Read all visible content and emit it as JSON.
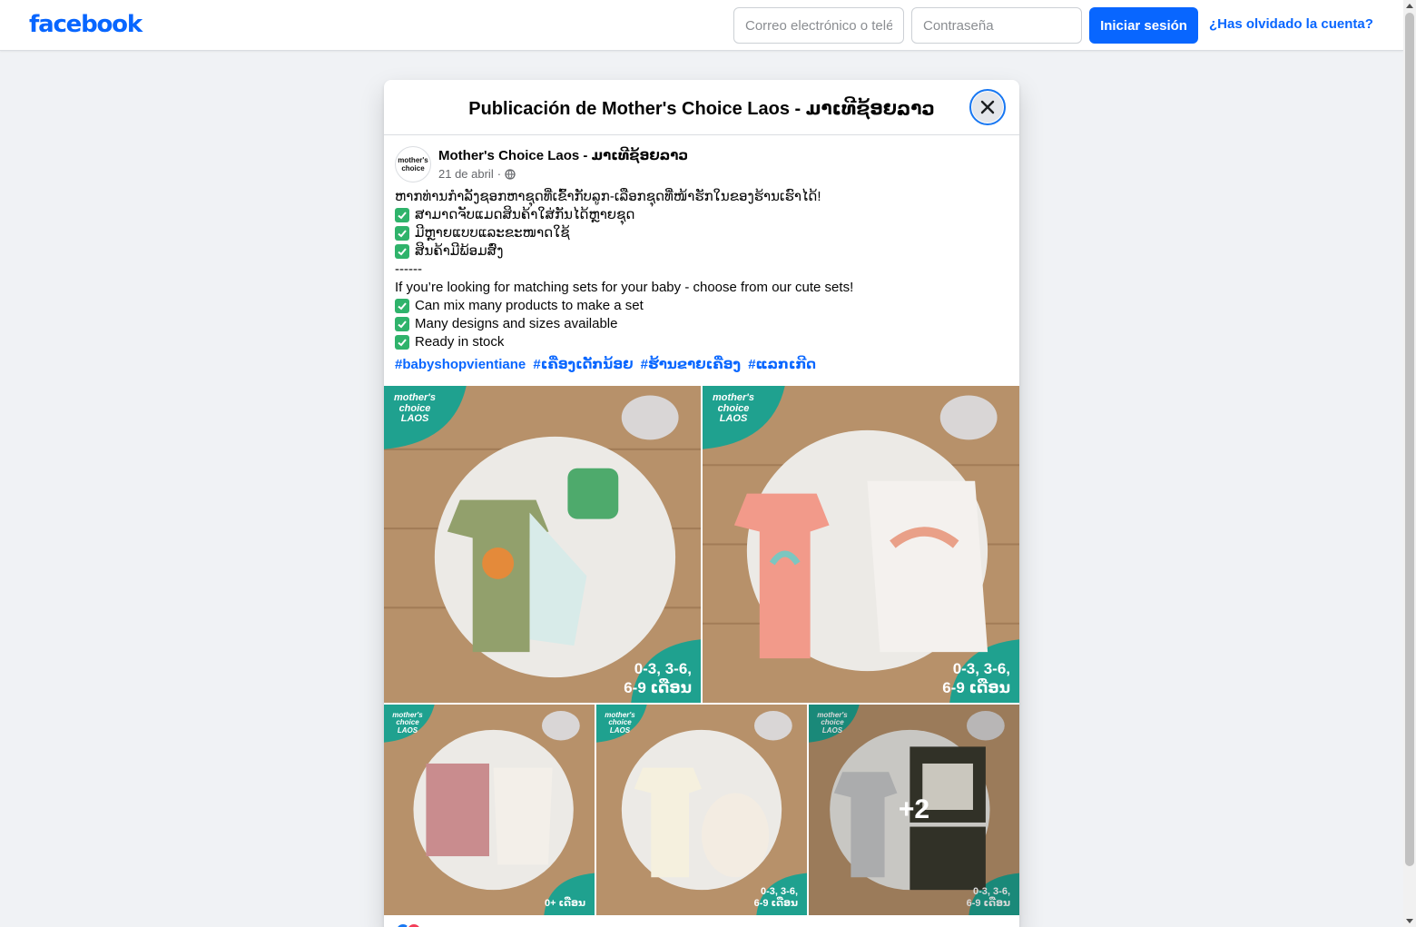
{
  "header": {
    "logo_text": "facebook",
    "email_placeholder": "Correo electrónico o teléfono",
    "password_placeholder": "Contraseña",
    "login_label": "Iniciar sesión",
    "forgot_label": "¿Has olvidado la cuenta?"
  },
  "dialog": {
    "title": "Publicación de Mother's Choice Laos - ມາເທີຊ້ອຍລາວ",
    "author": "Mother's Choice Laos - ມາເທີຊ້ອຍລາວ",
    "avatar_line1": "mother's",
    "avatar_line2": "choice",
    "date": "21 de abril",
    "separator": "·",
    "lines": [
      "ຫາກທ່ານກຳລັງຊອກຫາຊຸດທີ່ເຂົ້າກັບລູກ-ເລືອກຊຸດທີ່ໜ້າຮັກໃນຂອງຮ້ານເຮົາໄດ້!",
      "ສາມາດຈັບແມດສິນຄ້າໃສ່ກັນໄດ້ຫຼາຍຊຸດ",
      "ມີຫຼາຍແບບແລະຂະໜາດໃຊ້",
      "ສິນຄ້າມີພ້ອມສົ່ງ",
      "------",
      "If you’re looking for matching sets for your baby - choose from our cute sets!",
      "Can mix many products to make a set",
      "Many designs and sizes available",
      "Ready in stock"
    ],
    "hashtags": [
      "#babyshopvientiane",
      "#ເຄື່ອງເດັກນ້ອຍ",
      "#ຮ້ານຂາຍເຄື່ອງ",
      "#ແລກເກີດ"
    ],
    "photos": [
      {
        "brand": "mother's choice LAOS",
        "badge_line1": "0-3, 3-6,",
        "badge_line2": "6-9 ເດືອນ"
      },
      {
        "brand": "mother's choice LAOS",
        "badge_line1": "0-3, 3-6,",
        "badge_line2": "6-9 ເດືອນ"
      },
      {
        "brand": "mother's choice LAOS",
        "badge_line1": "",
        "badge_line2": "0+ ເດືອນ"
      },
      {
        "brand": "mother's choice LAOS",
        "badge_line1": "0-3, 3-6,",
        "badge_line2": "6-9 ເດືອນ"
      },
      {
        "brand": "mother's choice LAOS",
        "badge_line1": "0-3, 3-6,",
        "badge_line2": "6-9 ເດືອນ"
      }
    ],
    "more_photos": "+2"
  },
  "colors": {
    "brand_blue": "#0866ff",
    "teal": "#1fa18f",
    "check_green": "#2fb36b"
  },
  "icons": [
    "close-icon",
    "globe-icon",
    "check-icon"
  ]
}
